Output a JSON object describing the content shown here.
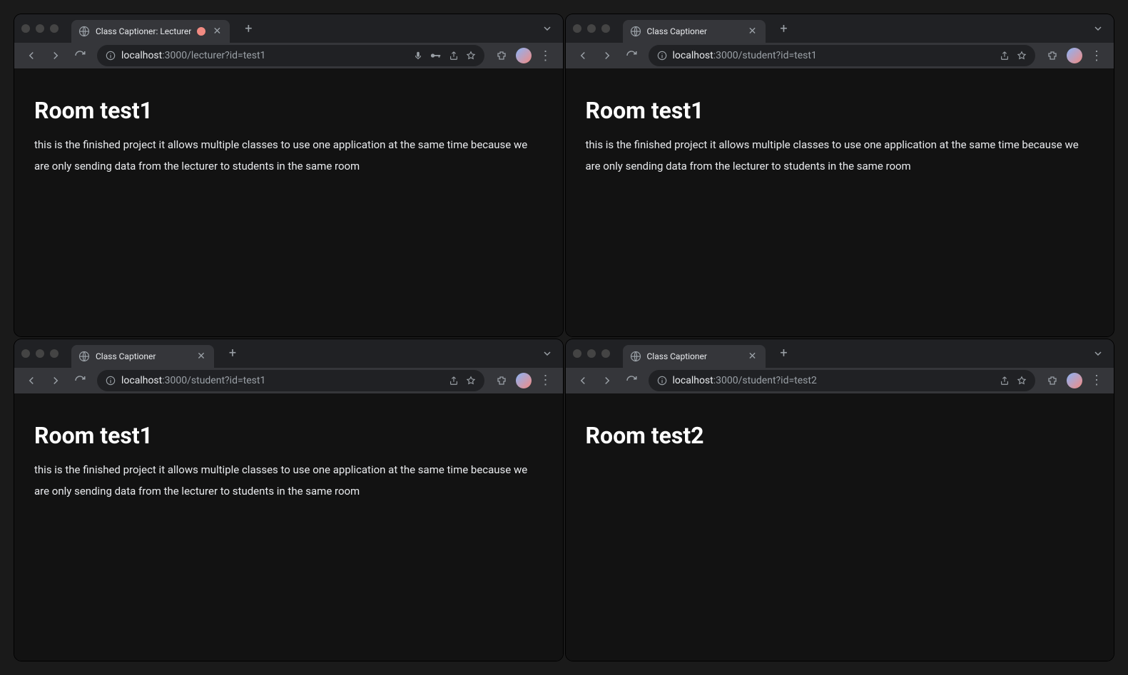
{
  "windows": [
    {
      "tab_title": "Class Captioner: Lecturer",
      "recording": true,
      "url_host": "localhost",
      "url_path": ":3000/lecturer?id=test1",
      "show_mic": true,
      "show_key": true,
      "page_heading": "Room test1",
      "page_body": "this is the finished project it allows multiple classes to use one application at the same time because we are only sending data from the lecturer to students in the same room"
    },
    {
      "tab_title": "Class Captioner",
      "recording": false,
      "url_host": "localhost",
      "url_path": ":3000/student?id=test1",
      "show_mic": false,
      "show_key": false,
      "page_heading": "Room test1",
      "page_body": "this is the finished project it allows multiple classes to use one application at the same time because we are only sending data from the lecturer to students in the same room"
    },
    {
      "tab_title": "Class Captioner",
      "recording": false,
      "url_host": "localhost",
      "url_path": ":3000/student?id=test1",
      "show_mic": false,
      "show_key": false,
      "page_heading": "Room test1",
      "page_body": "this is the finished project it allows multiple classes to use one application at the same time because we are only sending data from the lecturer to students in the same room"
    },
    {
      "tab_title": "Class Captioner",
      "recording": false,
      "url_host": "localhost",
      "url_path": ":3000/student?id=test2",
      "show_mic": false,
      "show_key": false,
      "page_heading": "Room test2",
      "page_body": ""
    }
  ]
}
